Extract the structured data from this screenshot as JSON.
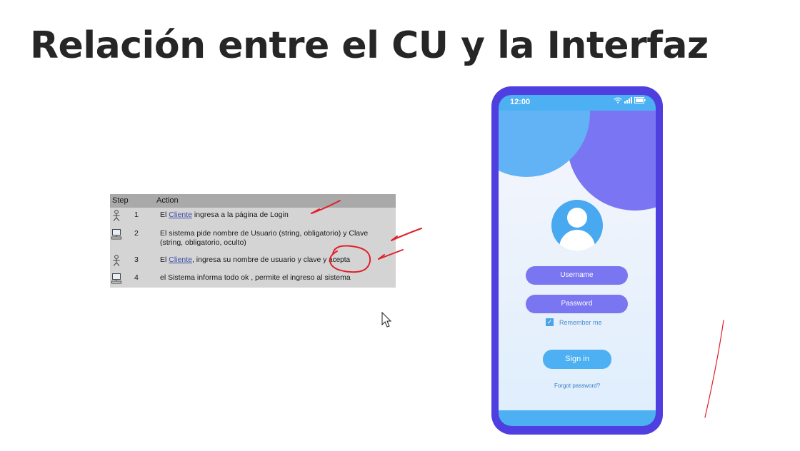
{
  "slide": {
    "title": "Relación entre el CU y la Interfaz"
  },
  "use_case_table": {
    "headers": {
      "step": "Step",
      "action": "Action"
    },
    "rows": [
      {
        "actor_icon": "actor-icon",
        "step": "1",
        "pre": "El ",
        "link": "Cliente",
        "post": " ingresa a la página de Login"
      },
      {
        "actor_icon": "computer-icon",
        "step": "2",
        "text": "El sistema pide nombre de Usuario (string, obligatorio) y Clave (string, obligatorio, oculto)"
      },
      {
        "actor_icon": "actor-icon",
        "step": "3",
        "pre": "El ",
        "link": "Cliente",
        "post": ", ingresa su nombre de usuario y clave",
        "annotation": "y acepta"
      },
      {
        "actor_icon": "computer-icon",
        "step": "4",
        "text": "el Sistema informa todo ok , permite el ingreso al sistema"
      }
    ]
  },
  "phone": {
    "status_time": "12:00",
    "username_label": "Username",
    "password_label": "Password",
    "remember_label": "Remember me",
    "remember_checked": true,
    "signin_label": "Sign in",
    "forgot_label": "Forgot password?",
    "icons": [
      "wifi-icon",
      "signal-icon",
      "battery-icon",
      "user-avatar-icon",
      "checkbox-icon"
    ]
  },
  "colors": {
    "phone_frame": "#4f3ee0",
    "accent_blue": "#4cb0f2",
    "field_purple": "#7a75f0",
    "annotation_red": "#e0202a",
    "title_text": "#262626"
  }
}
